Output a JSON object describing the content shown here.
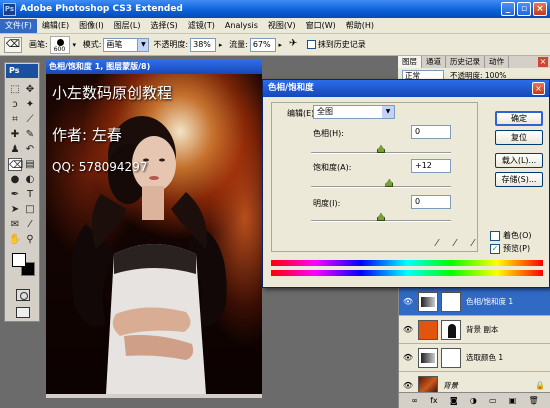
{
  "window": {
    "title": "Adobe Photoshop CS3 Extended",
    "buttons": [
      "_",
      "▫",
      "×"
    ]
  },
  "menu": {
    "items": [
      "文件(F)",
      "编辑(E)",
      "图像(I)",
      "图层(L)",
      "选择(S)",
      "滤镜(T)",
      "Analysis",
      "视图(V)",
      "窗口(W)",
      "帮助(H)"
    ]
  },
  "options": {
    "brush_label": "画笔:",
    "brush_size": "600",
    "mode_label": "模式:",
    "mode_value": "画笔",
    "opacity_label": "不透明度:",
    "opacity_value": "38%",
    "flow_label": "流量:",
    "flow_value": "67%",
    "history_label": "抹到历史记录"
  },
  "panel_tabs": [
    "图层",
    "通道",
    "历史记录",
    "动作"
  ],
  "panel_blend": "正常",
  "panel_opacity": "不透明度: 100%",
  "toolbox_badge": "Ps",
  "document": {
    "title": "色相/饱和度 1, 图层蒙版/8)",
    "watermark_line1": "小左数码原创教程",
    "watermark_line2": "作者: 左春",
    "watermark_line3": "QQ: 578094297"
  },
  "dialog": {
    "title": "色相/饱和度",
    "edit_label": "编辑(E):",
    "edit_value": "全图",
    "hue_label": "色相(H):",
    "hue_value": "0",
    "saturation_label": "饱和度(A):",
    "saturation_value": "+12",
    "lightness_label": "明度(I):",
    "lightness_value": "0",
    "ok": "确定",
    "reset": "复位",
    "load": "载入(L)...",
    "save": "存储(S)...",
    "colorize_label": "着色(O)",
    "preview_label": "预览(P)",
    "hue": 0,
    "saturation": 12,
    "lightness": 0,
    "range": [
      -100,
      100
    ],
    "hue_range": [
      -180,
      180
    ]
  },
  "layers": [
    {
      "name": "色相/饱和度 1",
      "thumb": "adj",
      "selected": true
    },
    {
      "name": "背景 副本",
      "thumb": "orange",
      "selected": false
    },
    {
      "name": "选取颜色 1",
      "thumb": "adj",
      "selected": false
    },
    {
      "name": "背景",
      "thumb": "photo",
      "selected": false
    }
  ],
  "colors": {
    "accent": "#316ac5",
    "title_blue": "#0a5fd8",
    "chrome": "#ece9d8"
  }
}
